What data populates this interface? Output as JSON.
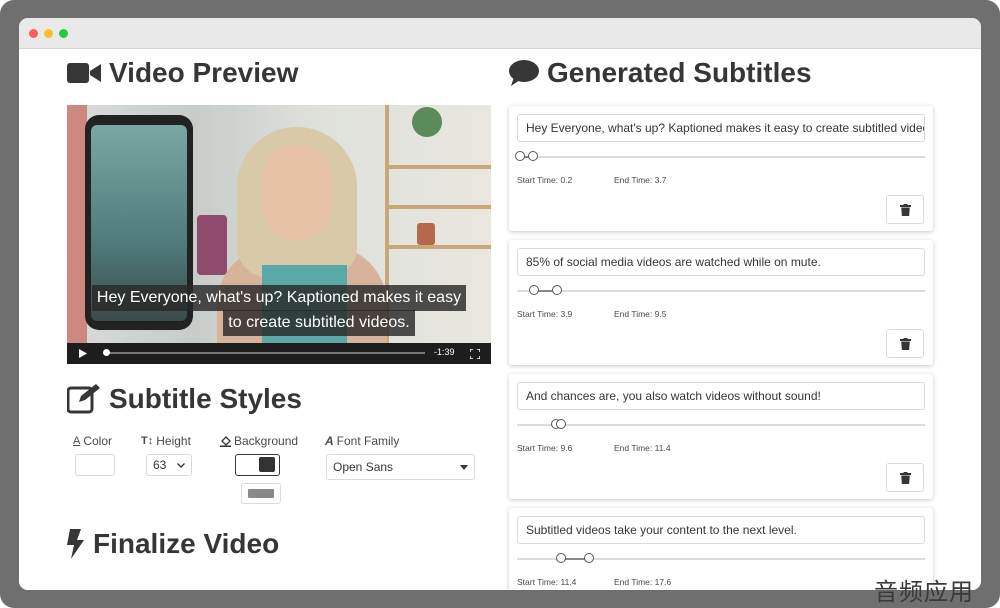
{
  "window": {
    "traffic_lights": [
      "#fc5f57",
      "#fdbd2e",
      "#28c840"
    ]
  },
  "video_preview": {
    "heading": "Video Preview",
    "caption_lines": [
      "Hey Everyone, what's up? Kaptioned makes it easy",
      "to create subtitled videos."
    ],
    "time_remaining": "-1:39",
    "progress": 0.01
  },
  "subtitle_styles": {
    "heading": "Subtitle Styles",
    "color_label": "Color",
    "height_label": "Height",
    "height_value": "63",
    "background_label": "Background",
    "font_family_label": "Font Family",
    "font_family_value": "Open Sans",
    "text_color": "#ffffff",
    "background_color": "#333333",
    "background_opacity_swatch": "#888888"
  },
  "finalize": {
    "heading": "Finalize Video",
    "button_colors": [
      "#3e8ed0",
      "#48c774"
    ]
  },
  "generated_subtitles": {
    "heading": "Generated Subtitles",
    "start_prefix": "Start Time: ",
    "end_prefix": "End Time: ",
    "items": [
      {
        "text": "Hey Everyone, what's up? Kaptioned makes it easy to create subtitled videos.",
        "start": "0.2",
        "end": "3.7"
      },
      {
        "text": "85% of social media videos are watched while on mute.",
        "start": "3.9",
        "end": "9.5"
      },
      {
        "text": "And chances are, you also watch videos without sound!",
        "start": "9.6",
        "end": "11.4"
      },
      {
        "text": "Subtitled videos take your content to the next level.",
        "start": "11.4",
        "end": "17.6"
      }
    ]
  },
  "watermark": "音频应用"
}
